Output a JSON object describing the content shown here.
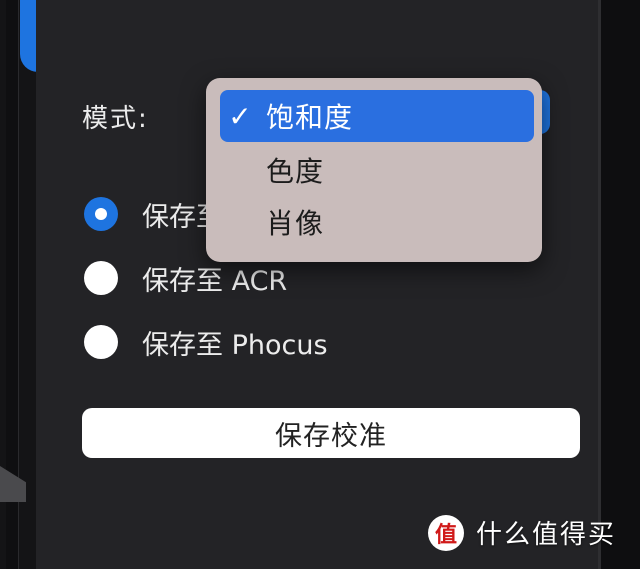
{
  "settings": {
    "mode_label": "模式:",
    "options": [
      {
        "label": "保存至",
        "selected": true
      },
      {
        "label": "保存至 ACR",
        "selected": false
      },
      {
        "label": "保存至 Phocus",
        "selected": false
      }
    ],
    "save_button_label": "保存校准"
  },
  "dropdown": {
    "items": [
      {
        "label": "饱和度",
        "selected": true,
        "check": "✓"
      },
      {
        "label": "色度",
        "selected": false,
        "check": ""
      },
      {
        "label": "肖像",
        "selected": false,
        "check": ""
      }
    ]
  },
  "watermark": {
    "logo": "值",
    "text": "什么值得买"
  },
  "colors": {
    "accent": "#1e74e0",
    "panel": "#232326",
    "menu_bg": "#c9bcbb"
  }
}
